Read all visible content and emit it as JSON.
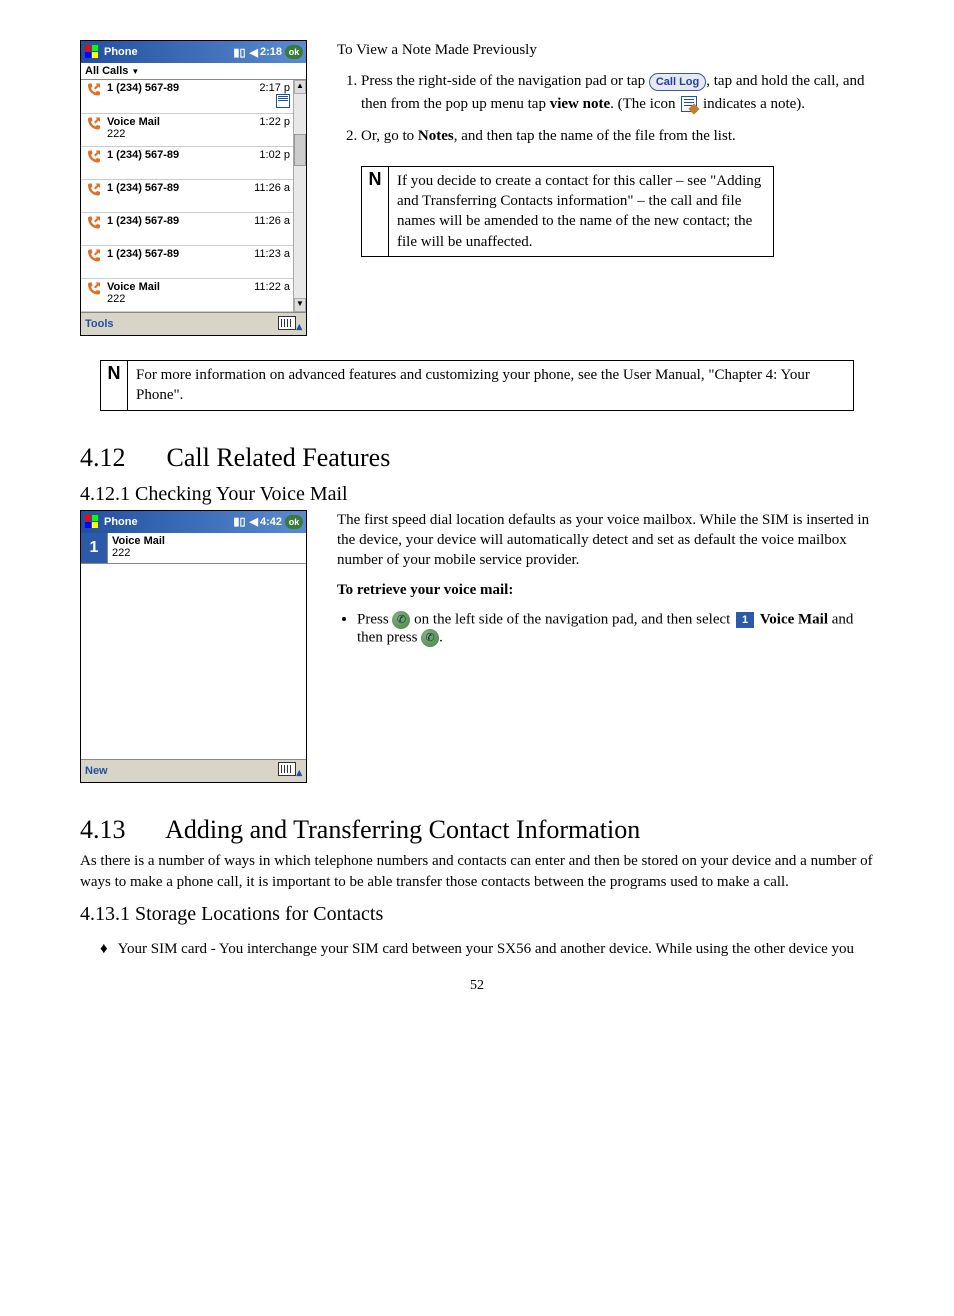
{
  "shot1": {
    "title": "Phone",
    "clock": "2:18",
    "ok": "ok",
    "filter": "All Calls",
    "rows": [
      {
        "num": "1 (234) 567-89",
        "sub": "",
        "time": "2:17 p",
        "note": true
      },
      {
        "num": "Voice Mail",
        "sub": "222",
        "time": "1:22 p",
        "note": false
      },
      {
        "num": "1 (234) 567-89",
        "sub": "",
        "time": "1:02 p",
        "note": false
      },
      {
        "num": "1 (234) 567-89",
        "sub": "",
        "time": "11:26 a",
        "note": false
      },
      {
        "num": "1 (234) 567-89",
        "sub": "",
        "time": "11:26 a",
        "note": false
      },
      {
        "num": "1 (234) 567-89",
        "sub": "",
        "time": "11:23 a",
        "note": false
      },
      {
        "num": "Voice Mail",
        "sub": "222",
        "time": "11:22 a",
        "note": false
      }
    ],
    "bottom": "Tools"
  },
  "right1": {
    "heading": "To View a Note Made Previously",
    "step1a": "Press the right-side of the navigation pad or tap ",
    "callLogBtn": "Call Log",
    "step1b": ", tap and hold the call, and then from the pop up menu tap ",
    "viewNote": "view note",
    "step1c": ". (The icon ",
    "step1d": " indicates a note).",
    "step2a": "Or, go to ",
    "notesBold": "Notes",
    "step2b": ", and then tap the name of the file from the list."
  },
  "noteBox1": "If you decide to create a contact for this caller – see \"Adding and Transferring Contacts information\" – the call and file names will be amended to the name of the new contact; the file will be unaffected.",
  "noteBox2": "For more information on advanced features and customizing your phone, see the User Manual, \"Chapter 4: Your Phone\".",
  "sec412": {
    "num": "4.12",
    "title": "Call Related Features"
  },
  "sec4121": {
    "title": "4.12.1  Checking Your Voice Mail"
  },
  "shot2": {
    "title": "Phone",
    "clock": "4:42",
    "ok": "ok",
    "speedNum": "1",
    "speedName": "Voice Mail",
    "speedSub": "222",
    "bottom": "New"
  },
  "para4121": "The first speed dial location defaults as your voice mailbox.  While the SIM is inserted in the device, your device will automatically detect and set as default the voice mailbox number of your mobile service provider.",
  "retrieveHead": "To retrieve your voice mail:",
  "retrieve1a": "Press ",
  "retrieve1b": " on the left side of the navigation pad, and then select ",
  "speedBadge": "1",
  "voiceMailBold": "Voice Mail",
  "retrieve1c": " and then press ",
  "retrieve1d": ".",
  "sec413": {
    "num": "4.13",
    "title": "Adding and Transferring Contact Information"
  },
  "para413": "As there is a number of ways in which telephone numbers and contacts can enter and then be stored on your device and a number of ways to make a phone call, it is important to be able transfer those contacts between the programs used to make a call.",
  "sec4131": {
    "title": "4.13.1  Storage Locations for Contacts"
  },
  "bullet4131": "Your SIM card - You interchange your SIM card between your SX56 and another device.  While using the other device you",
  "pageNum": "52"
}
